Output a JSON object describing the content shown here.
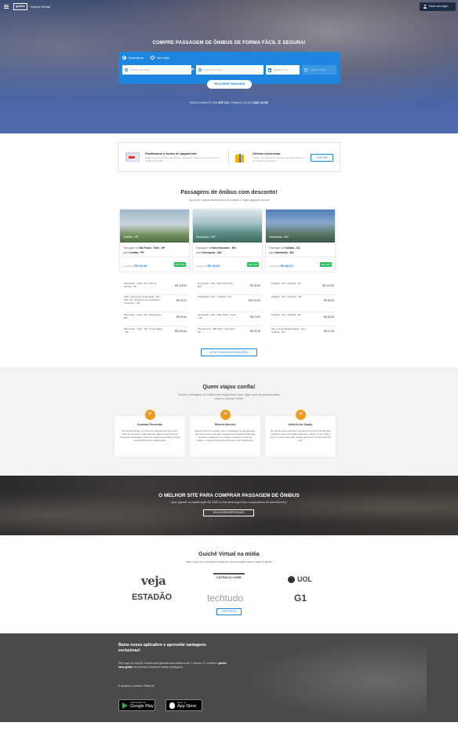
{
  "header": {
    "logo": "guichê",
    "site_name": "Guichê Virtual",
    "login": "Fazer seu login"
  },
  "hero": {
    "title": "COMPRE PASSAGEM DE ÔNIBUS DE FORMA FÁCIL E SEGURA!",
    "trip_types": [
      "Somente ida",
      "Ida e volta"
    ],
    "origin_placeholder": "Saindo de onde?",
    "destination_placeholder": "Indo para onde?",
    "date_go": "Quando vai?",
    "date_back": "Quando volta?",
    "search_button": "PROCURAR PASSAGEM",
    "stats_prefix": "PARCELAMENTO EM",
    "stats_value": "ATÉ 12X",
    "stats_mid": "| ÔNIBUS AGORA",
    "stats_value2": "SAIS JÁ DE"
  },
  "features": {
    "pay_title": "Facilitamos a forma de pagamento",
    "pay_desc": "Pagamentos com Mercado Pago, cartão de crédito ou em até 12x no cartão de crédito",
    "offers_title": "Ofertas exclusivas",
    "offers_desc": "Cupons de desconto, passagens mais baratas e as melhores garantias",
    "accept_button": "ACEITAR"
  },
  "promos": {
    "title": "Passagens de ônibus com desconto!",
    "subtitle": "Aproveite nossos destinos em promoção e viaje pagando menos",
    "cards": [
      {
        "city": "Curitiba - PR",
        "from_label": "Passagem de",
        "from": "São Paulo - Tietê - SP",
        "to_label": "para",
        "to": "Curitiba - PR",
        "price_label": "a partir de",
        "price": "R$ 62,46",
        "badge": "22% OFF"
      },
      {
        "city": "Divinópolis - MG",
        "from_label": "Passagem de",
        "from": "Belo Horizonte - MG",
        "to_label": "para",
        "to": "Divinópolis - MG",
        "price_label": "a partir de",
        "price": "R$ 36,80",
        "badge": "40% OFF"
      },
      {
        "city": "Uberlândia - MG",
        "from_label": "Passagem de",
        "from": "Goiânia - GO",
        "to_label": "para",
        "to": "Uberlândia - MG",
        "price_label": "a partir de",
        "price": "R$ 80,23",
        "badge": "30% OFF"
      }
    ],
    "routes": [
      [
        {
          "route": "São Paulo - Tietê - SP > Rio de Janeiro - RJ",
          "price": "R$ 119,00"
        },
        {
          "route": "CDH - Aeroporto Congonhas - SP > GRU T3 - Aeroporto de Guarulhos - Terminal 3 - SP",
          "price": "R$ 30,00"
        },
        {
          "route": "São Paulo - Tietê - SP > Divinópolis - MG",
          "price": "R$ 99,90"
        },
        {
          "route": "São Paulo - Tietê - SP > Porto Alegre - RS",
          "price": "R$ 126,34"
        }
      ],
      [
        {
          "route": "Divinópolis - MG > Belo Horizonte - MG",
          "price": "R$ 34,99"
        },
        {
          "route": "Uberlândia - MG > Goiânia - GO",
          "price": "R$ 100,00"
        },
        {
          "route": "Divinópolis - MG > São Paulo - Tietê - SP",
          "price": "R$ 79,90"
        },
        {
          "route": "Juiz de Fora - (BR 267) > Três Rios - RJ",
          "price": "R$ 32,19"
        }
      ],
      [
        {
          "route": "Goiânia - GO > Palmas - TO",
          "price": "R$ 119,00"
        },
        {
          "route": "Goiânia - GO > Caruaru - PE",
          "price": "R$ 90,00"
        },
        {
          "route": "Goiânia - GO > Brasília - DF",
          "price": "R$ 54,99"
        },
        {
          "route": "São Luís de Montes Belos - GO > Goiânia - GO",
          "price": "R$ 17,36"
        }
      ]
    ],
    "more_button": "VEJA TODAS AS PROMOÇÕES"
  },
  "testimonials": {
    "title": "Quem viajou confia!",
    "subtitle": "Compre passagens de ônibus com segurança e paz, veja o que as pessoas falam sobre o Guichê Virtual",
    "items": [
      {
        "name": "Amanda Farronato",
        "text": "No Guichê Virtual, eu recebi um atendimento em pouco mais de uma hora, muito eficiente. Mesmo depois de ter comprado a passagem, fiquei com algumas dúvidas e foram respondidas muito rapidamente."
      },
      {
        "name": "Rebeca Borrêio",
        "text": "Quero te fazer um elogio sobre a satisfação do atendimento, aprendi com as respostas, Agradeço ao Guichê Virtual pela atenção e paciência. Ao escolher a viagem na tela de viagem, a viagem aconteceu de forma muito satisfatória."
      },
      {
        "name": "Anilório de Araújo",
        "text": "Já, se não fosse obra bem-fe outra dos Guichê Virtual mais parabéns visto você estão ajudando a trazer a mim mulher pra 1 e a esse nova vida, ajudar aos menos, foi bem feito da sua."
      }
    ]
  },
  "best_site": {
    "title": "O MELHOR SITE PARA COMPRAR PASSAGEM DE ÔNIBUS",
    "subtitle": "Quer garantir a classificação RA 1000 no Reclame Aqui como compradores de atendimento?",
    "button": "VEJA NOSSA REPUTAÇÃO"
  },
  "media": {
    "title": "Guichê Virtual na mídia",
    "subtitle": "Veja o que os principais canais de comunicação dizem sobre a gente",
    "logos": [
      "veja",
      "CATRACA LIVRE",
      "UOL",
      "ESTADÃO",
      "techtudo",
      "G1"
    ],
    "button": "VER TODOS"
  },
  "app": {
    "title": "Baixe nosso aplicativo e aproveite vantagens exclusivas!",
    "text1_a": "Pelo app do Guichê Virtual você garante sua poltrona em 1 minuto. E o melhor:",
    "text1_b": "ganhe taxa grátis",
    "text1_c": "na primeira compra e outras vantagens.",
    "text2": "É simples e prático. Baixe já!",
    "google_small": "DISPONÍVEL NO",
    "google_big": "Google Play",
    "apple_small": "Baixar na",
    "apple_big": "App Store"
  },
  "colors": {
    "primary": "#1d86e0",
    "badge": "#2dbf5a",
    "quote": "#f29b18"
  }
}
